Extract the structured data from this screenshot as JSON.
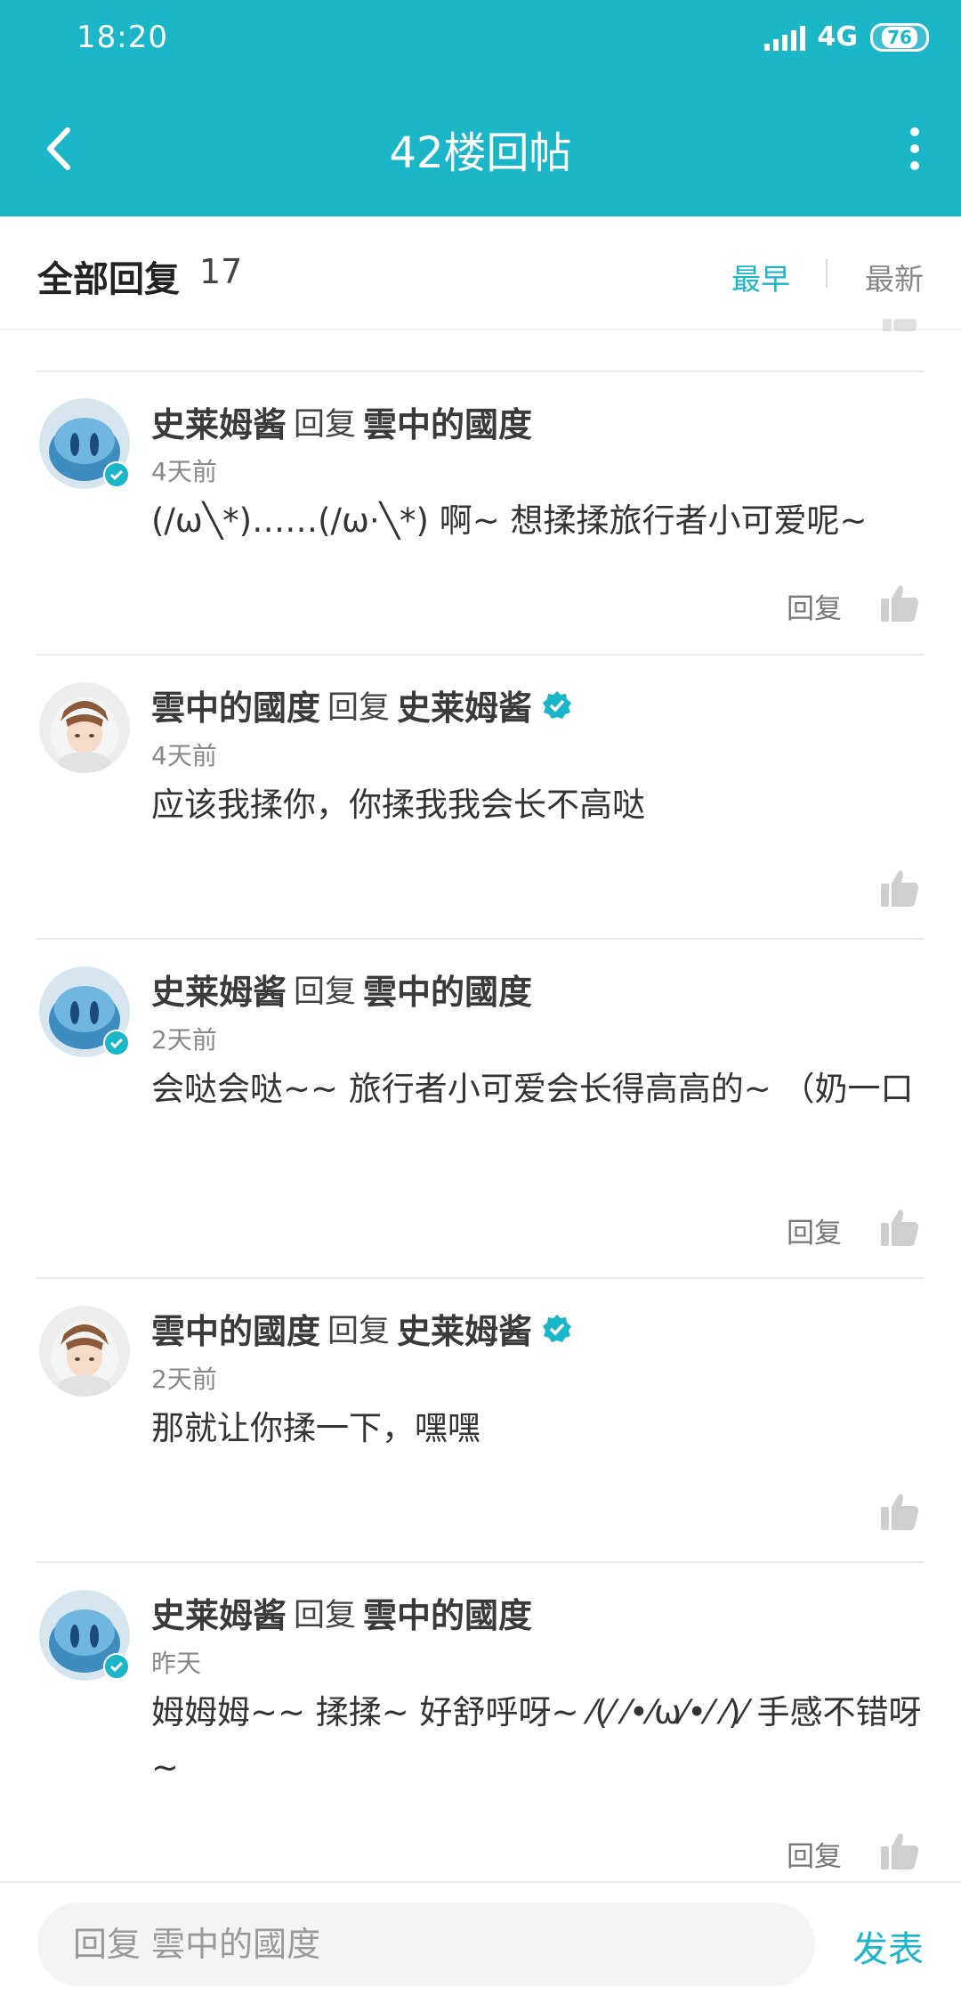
{
  "status": {
    "time": "18:20",
    "network": "4G",
    "battery": "76"
  },
  "nav": {
    "title": "42楼回帖"
  },
  "sort": {
    "title": "全部回复",
    "count": "17",
    "earliest": "最早",
    "latest": "最新"
  },
  "reply_word": "回复",
  "comments": [
    {
      "user": "史莱姆酱",
      "reply_to": "雲中的國度",
      "time": "4天前",
      "text": "(/ω╲*)……(/ω·╲*) 啊~ 想揉揉旅行者小可爱呢~",
      "reply_label": "回复"
    },
    {
      "user": "雲中的國度",
      "reply_to": "史莱姆酱",
      "time": "4天前",
      "text": "应该我揉你，你揉我我会长不高哒",
      "reply_label": ""
    },
    {
      "user": "史莱姆酱",
      "reply_to": "雲中的國度",
      "time": "2天前",
      "text": "会哒会哒~~ 旅行者小可爱会长得高高的~ （奶一口",
      "reply_label": "回复"
    },
    {
      "user": "雲中的國度",
      "reply_to": "史莱姆酱",
      "time": "2天前",
      "text": "那就让你揉一下，嘿嘿",
      "reply_label": ""
    },
    {
      "user": "史莱姆酱",
      "reply_to": "雲中的國度",
      "time": "昨天",
      "text": "姆姆姆~~ 揉揉~ 好舒呼呀~ ⁄(⁄ ⁄•⁄ω⁄•⁄ ⁄)⁄ 手感不错呀~",
      "reply_label": "回复"
    }
  ],
  "footer": {
    "placeholder": "回复 雲中的國度",
    "send": "发表"
  },
  "colors": {
    "accent": "#1bb6c7"
  }
}
